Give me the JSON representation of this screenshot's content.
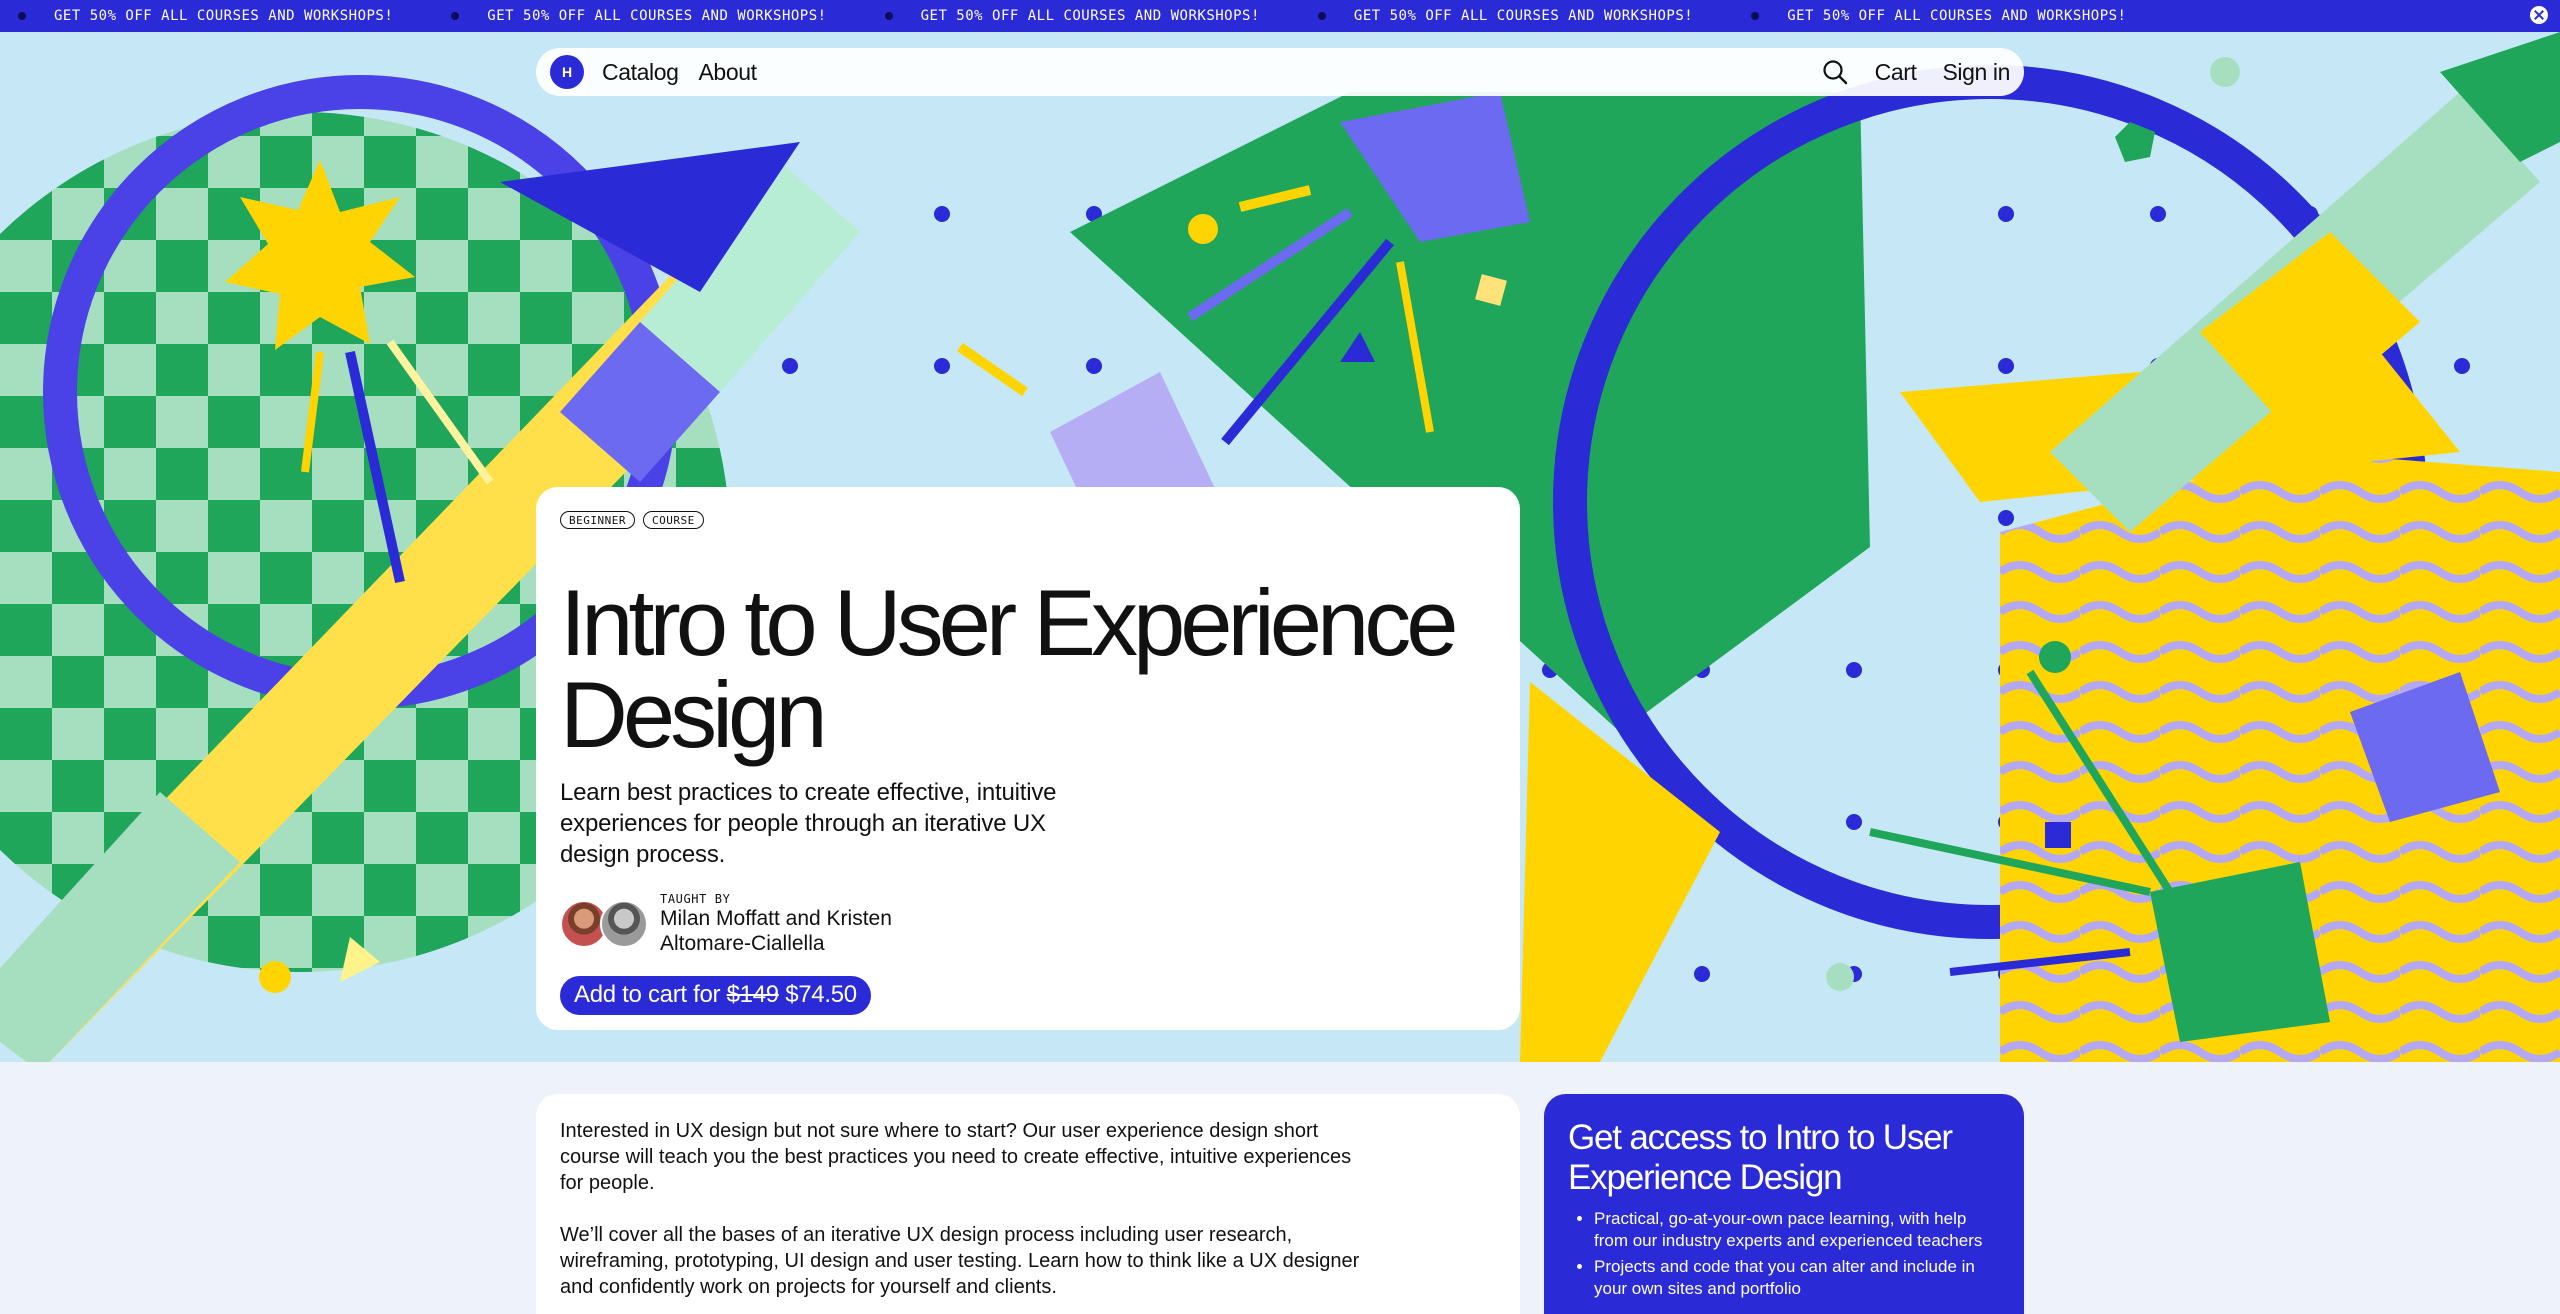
{
  "promo": {
    "items": [
      "GET 50% OFF ALL COURSES AND WORKSHOPS!",
      "GET 50% OFF ALL COURSES AND WORKSHOPS!",
      "GET 50% OFF ALL COURSES AND WORKSHOPS!",
      "GET 50% OFF ALL COURSES AND WORKSHOPS!",
      "GET 50% OFF ALL COURSES AND WORKSHOPS!"
    ]
  },
  "nav": {
    "logo_text": "H",
    "catalog": "Catalog",
    "about": "About",
    "cart": "Cart",
    "signin": "Sign in"
  },
  "course": {
    "tags": [
      "BEGINNER",
      "COURSE"
    ],
    "title": "Intro to User Experience Design",
    "description": "Learn best practices to create effective, intuitive experiences for people through an iterative UX design process.",
    "taught_by_label": "TAUGHT BY",
    "teachers": "Milan Moffatt and Kristen Altomare-Ciallella",
    "cart_prefix": "Add to cart for",
    "old_price": "$149",
    "new_price": "$74.50"
  },
  "about": {
    "paragraphs": [
      "Interested in UX design but not sure where to start? Our user experience design short course will teach you the best practices you need to create effective, intuitive experiences for people.",
      "We’ll cover all the bases of an iterative UX design process including user research, wireframing, prototyping, UI design and user testing. Learn how to think like a UX designer and confidently work on projects for yourself and clients."
    ]
  },
  "access": {
    "title": "Get access to Intro to User Experience Design",
    "bullets": [
      "Practical, go-at-your-own pace learning, with help from our industry experts and experienced teachers",
      "Projects and code that you can alter and include in your own sites and portfolio"
    ]
  },
  "colors": {
    "brand_blue": "#2a2ad6",
    "green": "#1fa65a",
    "yellow": "#ffd400",
    "lavender": "#a9a6f5"
  }
}
